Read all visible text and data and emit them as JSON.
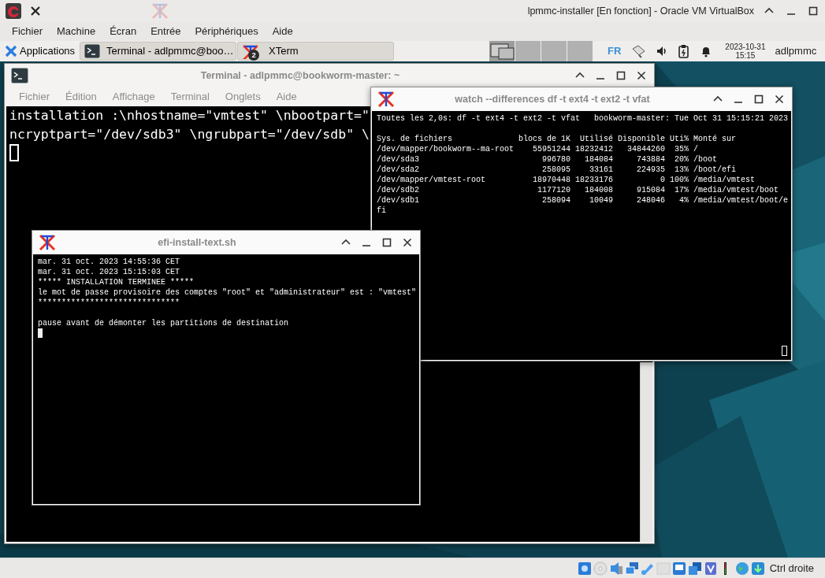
{
  "vbox": {
    "title": "lpmmc-installer [En fonction] - Oracle VM VirtualBox",
    "menu": [
      "Fichier",
      "Machine",
      "Écran",
      "Entrée",
      "Périphériques",
      "Aide"
    ],
    "host_key": "Ctrl droite"
  },
  "panel": {
    "applications": "Applications",
    "tasks": [
      {
        "kind": "terminal",
        "label": "Terminal - adlpmmc@boo…"
      },
      {
        "kind": "xterm",
        "label": "XTerm",
        "badge": "2"
      }
    ],
    "workspaces": [
      {
        "selected": true
      },
      {
        "selected": false
      },
      {
        "selected": false
      },
      {
        "selected": false
      }
    ],
    "keyboard_layout": "FR",
    "date": "2023-10-31",
    "time": "15:15",
    "user": "adlpmmc"
  },
  "terminal": {
    "title": "Terminal - adlpmmc@bookworm-master: ~",
    "menu": [
      "Fichier",
      "Édition",
      "Affichage",
      "Terminal",
      "Onglets",
      "Aide"
    ],
    "lines": [
      "installation :\\nhostname=\"vmtest\" \\nbootpart=\"",
      "ncryptpart=\"/dev/sdb3\" \\ngrubpart=\"/dev/sdb\" \\"
    ]
  },
  "watch": {
    "title": "watch --differences df -t ext4 -t ext2 -t vfat",
    "header_line": "Toutes les 2,0s: df -t ext4 -t ext2 -t vfat   bookworm-master: Tue Oct 31 15:15:21 2023",
    "table": {
      "columns": [
        "Sys. de fichiers",
        "blocs de 1K",
        "Utilisé",
        "Disponible",
        "Uti%",
        "Monté sur"
      ],
      "rows": [
        [
          "/dev/mapper/bookworm--ma-root",
          "55951244",
          "18232412",
          "34844260",
          "35%",
          "/"
        ],
        [
          "/dev/sda3",
          "996780",
          "184084",
          "743884",
          "20%",
          "/boot"
        ],
        [
          "/dev/sda2",
          "258095",
          "33161",
          "224935",
          "13%",
          "/boot/efi"
        ],
        [
          "/dev/mapper/vmtest-root",
          "18970448",
          "18233176",
          "0",
          "100%",
          "/media/vmtest"
        ],
        [
          "/dev/sdb2",
          "1177120",
          "184008",
          "915084",
          "17%",
          "/media/vmtest/boot"
        ],
        [
          "/dev/sdb1",
          "258094",
          "10049",
          "248046",
          "4%",
          "/media/vmtest/boot/efi"
        ]
      ]
    }
  },
  "script": {
    "title": "efi-install-text.sh",
    "lines": [
      "mar. 31 oct. 2023 14:55:36 CET",
      "mar. 31 oct. 2023 15:15:03 CET",
      "***** INSTALLATION TERMINEE *****",
      "le mot de passe provisoire des comptes \"root\" et \"administrateur\" est : \"vmtest\"",
      "******************************"
    ],
    "prompt": "pause avant de démonter les partitions de destination"
  }
}
